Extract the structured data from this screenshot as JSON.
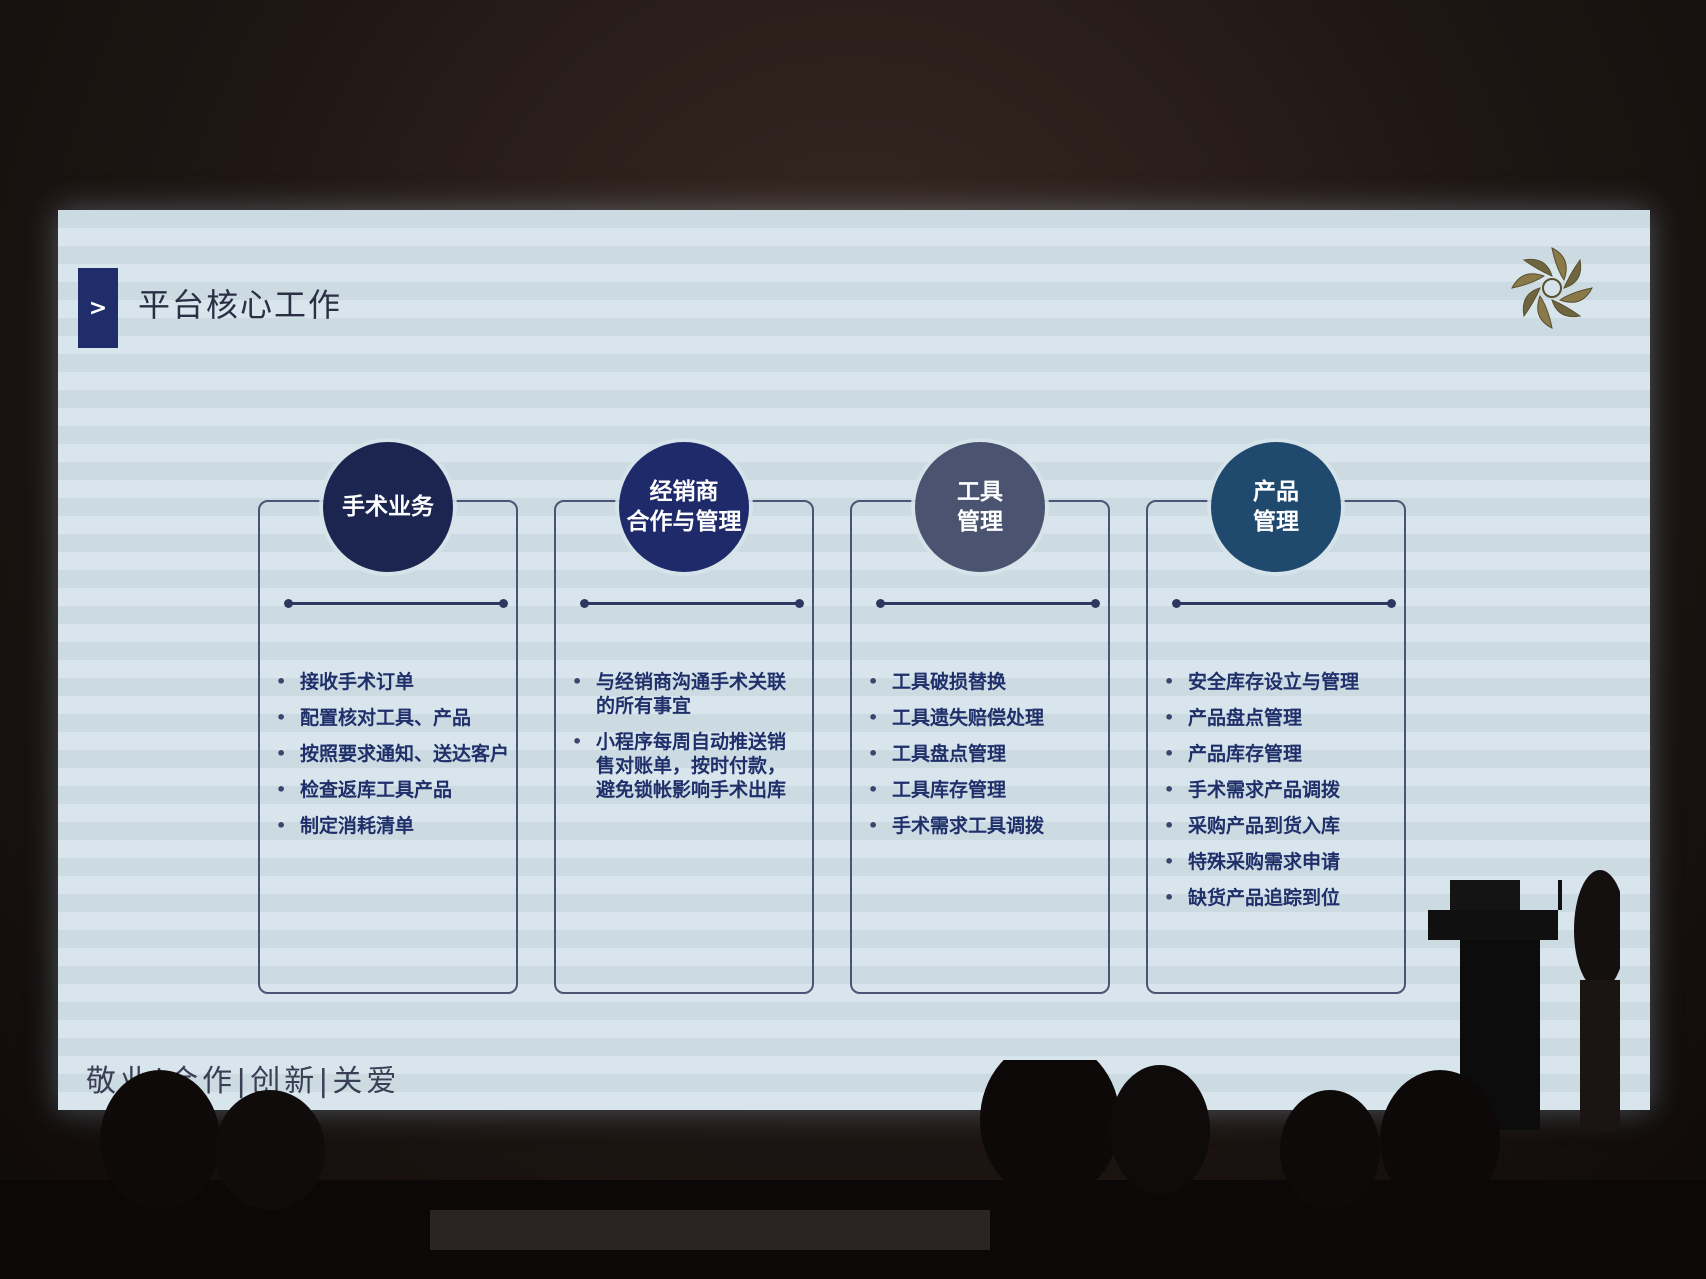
{
  "slide": {
    "title": "平台核心工作",
    "tab_symbol": ">",
    "motto": "敬业|合作|创新|关爱",
    "logo_icon": "pinwheel-logo-icon",
    "colors": {
      "screen_bg": "#d6e3ea",
      "accent_navy": "#1f2e6b",
      "accent_gray": "#4a5470",
      "accent_teal": "#1f4a6e",
      "text_blue": "#1f2f6a"
    }
  },
  "cards": [
    {
      "heading": "手术业务",
      "items": [
        "接收手术订单",
        "配置核对工具、产品",
        "按照要求通知、送达客户",
        "检查返库工具产品",
        "制定消耗清单"
      ]
    },
    {
      "heading": "经销商\n合作与管理",
      "items": [
        "与经销商沟通手术关联\n的所有事宜",
        "小程序每周自动推送销\n售对账单，按时付款，\n避免锁帐影响手术出库"
      ]
    },
    {
      "heading": "工具\n管理",
      "items": [
        "工具破损替换",
        "工具遗失赔偿处理",
        "工具盘点管理",
        "工具库存管理",
        "手术需求工具调拨"
      ]
    },
    {
      "heading": "产品\n管理",
      "items": [
        "安全库存设立与管理",
        "产品盘点管理",
        "产品库存管理",
        "手术需求产品调拨",
        "采购产品到货入库",
        "特殊采购需求申请",
        "缺货产品追踪到位"
      ]
    }
  ]
}
